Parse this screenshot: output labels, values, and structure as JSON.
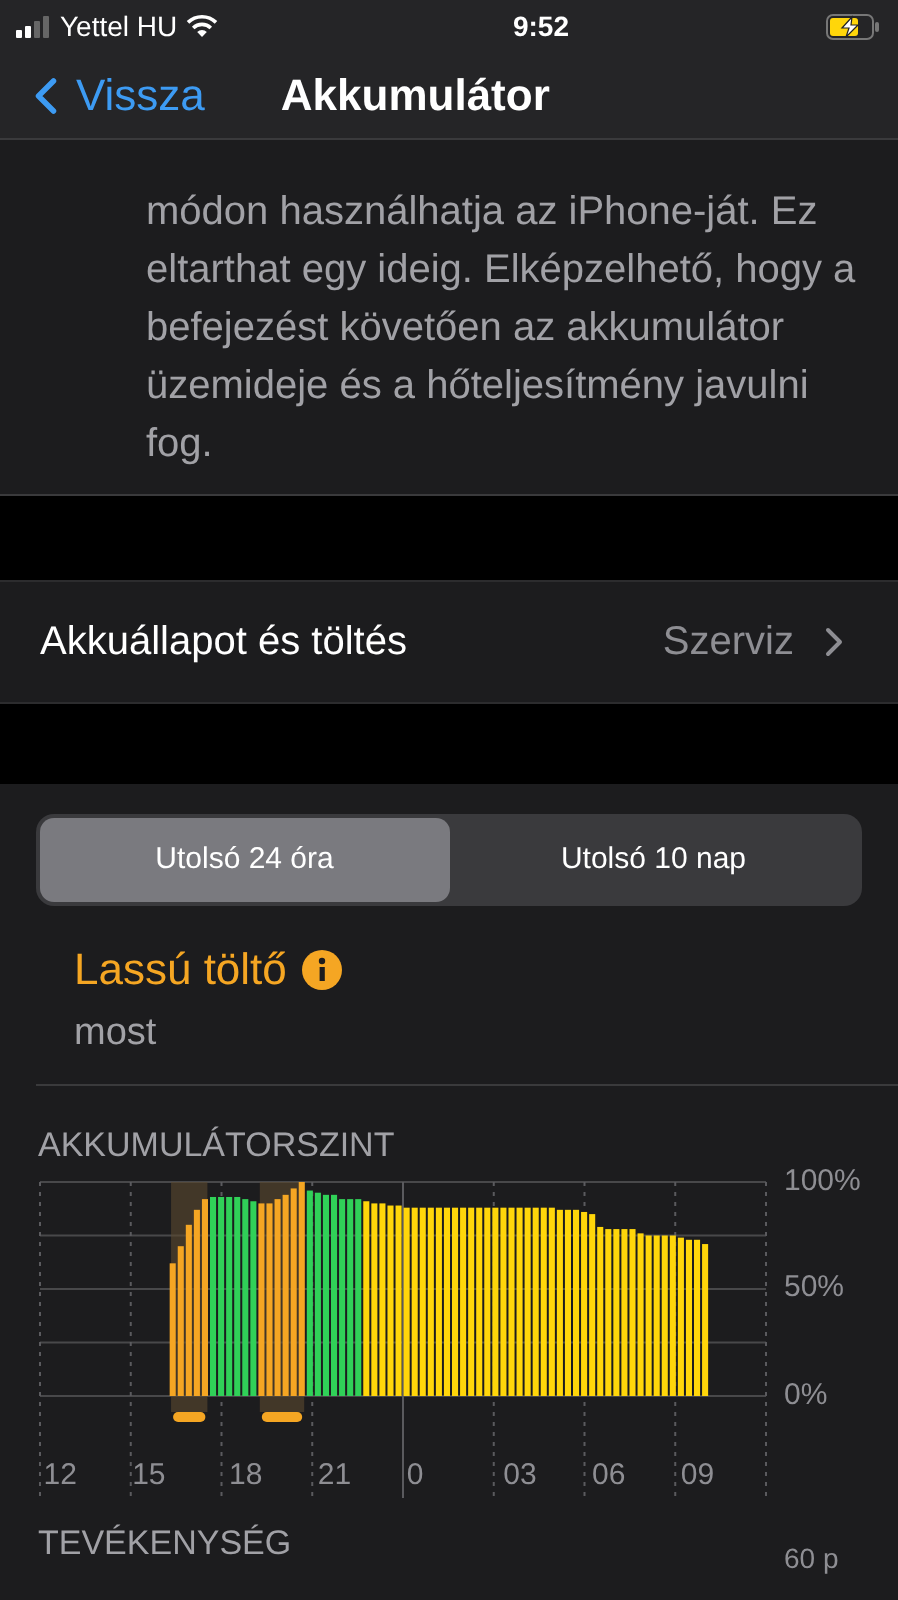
{
  "status_bar": {
    "carrier": "Yettel HU",
    "time": "9:52"
  },
  "nav": {
    "back": "Vissza",
    "title": "Akkumulátor"
  },
  "info_text": "módon használhatja az iPhone-ját. Ez eltarthat egy ideig. Elképzelhető, hogy a befejezést követően az akkumulátor üzemideje és a hőteljesítmény javulni fog.",
  "health_row": {
    "label": "Akkuállapot és töltés",
    "value": "Szerviz"
  },
  "tabs": [
    {
      "label": "Utolsó 24 óra",
      "selected": true
    },
    {
      "label": "Utolsó 10 nap",
      "selected": false
    }
  ],
  "charger": {
    "title": "Lassú töltő",
    "time": "most"
  },
  "battery_section": {
    "title": "AKKUMULÁTORSZINT",
    "chart_data": {
      "type": "bar",
      "stacked": true,
      "categories": [
        null,
        null,
        "12",
        null,
        null,
        null,
        null,
        null,
        null,
        null,
        null,
        null,
        null,
        "15",
        null,
        null,
        null,
        null,
        null,
        null,
        null,
        null,
        null,
        null,
        null,
        "18",
        null,
        null,
        null,
        null,
        null,
        null,
        null,
        null,
        null,
        null,
        "21",
        null,
        null,
        null,
        null,
        null,
        null,
        null,
        null,
        null,
        "0",
        null,
        null,
        null,
        null,
        null,
        null,
        null,
        null,
        null,
        null,
        null,
        null,
        "03",
        null,
        null,
        null,
        null,
        null,
        null,
        null,
        null,
        null,
        null,
        "06",
        null,
        null,
        null,
        null,
        null,
        null,
        null,
        null,
        null,
        null,
        "09",
        null,
        null,
        null,
        null,
        null,
        null,
        null,
        null
      ],
      "series": [
        {
          "color": "#f5a623",
          "values": [
            null,
            null,
            null,
            null,
            null,
            null,
            null,
            null,
            null,
            null,
            null,
            null,
            null,
            null,
            null,
            null,
            62,
            70,
            80,
            87,
            92,
            null,
            null,
            null,
            null,
            null,
            null,
            90,
            90,
            92,
            94,
            97,
            100,
            null,
            null,
            null,
            null,
            null,
            null,
            null,
            null,
            null,
            null,
            null,
            null,
            null,
            null,
            null,
            null,
            null,
            null,
            null,
            null,
            null,
            null,
            null,
            null,
            null,
            null,
            null,
            null,
            null,
            null,
            null,
            null,
            null,
            null,
            null,
            null,
            null,
            null,
            null,
            null,
            null,
            null,
            null,
            null,
            null,
            null,
            null,
            null,
            null,
            null,
            null,
            null,
            null,
            null,
            null,
            null,
            null
          ]
        },
        {
          "color": "#30d158",
          "values": [
            null,
            null,
            null,
            null,
            null,
            null,
            null,
            null,
            null,
            null,
            null,
            null,
            null,
            null,
            null,
            null,
            null,
            null,
            null,
            null,
            null,
            93,
            93,
            93,
            93,
            92,
            91,
            null,
            null,
            null,
            null,
            null,
            null,
            96,
            95,
            94,
            94,
            92,
            92,
            92,
            null,
            null,
            null,
            null,
            null,
            null,
            null,
            null,
            null,
            null,
            null,
            null,
            null,
            null,
            null,
            null,
            null,
            null,
            null,
            null,
            null,
            null,
            null,
            null,
            null,
            null,
            null,
            null,
            null,
            null,
            null,
            null,
            null,
            null,
            null,
            null,
            null,
            null,
            null,
            null,
            null,
            null,
            null,
            null,
            null,
            null,
            null,
            null,
            null,
            null
          ]
        },
        {
          "color": "#ffd60a",
          "values": [
            null,
            null,
            null,
            null,
            null,
            null,
            null,
            null,
            null,
            null,
            null,
            null,
            null,
            null,
            null,
            null,
            null,
            null,
            null,
            null,
            null,
            null,
            null,
            null,
            null,
            null,
            null,
            null,
            null,
            null,
            null,
            null,
            null,
            null,
            null,
            null,
            null,
            null,
            null,
            null,
            91,
            90,
            90,
            89,
            89,
            88,
            88,
            88,
            88,
            88,
            88,
            88,
            88,
            88,
            88,
            88,
            88,
            88,
            88,
            88,
            88,
            88,
            88,
            88,
            87,
            87,
            87,
            86,
            85,
            79,
            78,
            78,
            78,
            78,
            76,
            75,
            75,
            75,
            75,
            74,
            73,
            73,
            71,
            null,
            null,
            null,
            null,
            null,
            null,
            null
          ]
        }
      ],
      "ylim": [
        0,
        100
      ],
      "yticks": [
        {
          "value": 0,
          "label": "0%"
        },
        {
          "value": 50,
          "label": "50%"
        },
        {
          "value": 100,
          "label": "100%"
        }
      ]
    }
  },
  "activity_section": {
    "title": "TEVÉKENYSÉG",
    "axis_label": "60 p"
  }
}
